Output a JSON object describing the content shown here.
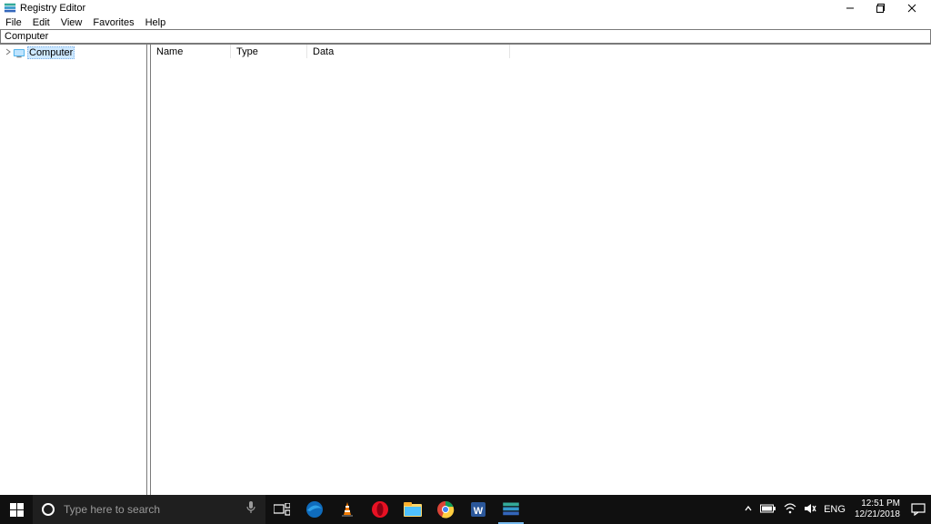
{
  "window": {
    "title": "Registry Editor"
  },
  "menu": {
    "file": "File",
    "edit": "Edit",
    "view": "View",
    "favorites": "Favorites",
    "help": "Help"
  },
  "address": {
    "value": "Computer"
  },
  "tree": {
    "root": {
      "label": "Computer"
    }
  },
  "columns": {
    "name": "Name",
    "type": "Type",
    "data": "Data"
  },
  "taskbar": {
    "search_placeholder": "Type here to search",
    "language": "ENG",
    "time": "12:51 PM",
    "date": "12/21/2018"
  }
}
